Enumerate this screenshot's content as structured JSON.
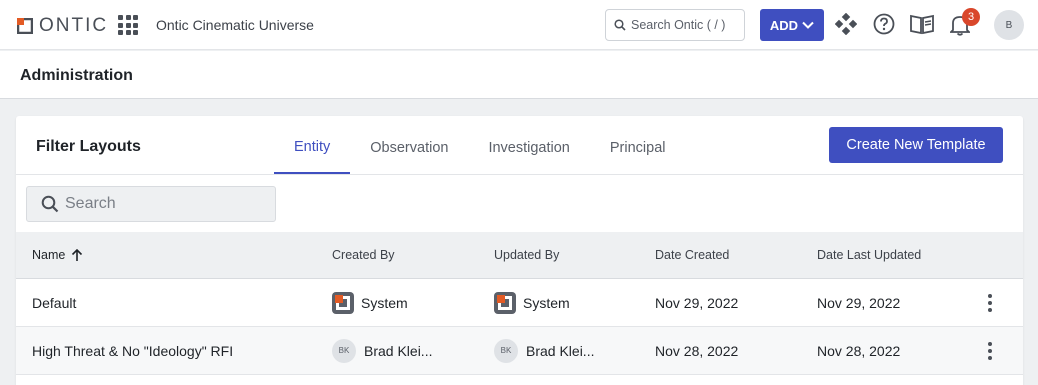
{
  "topbar": {
    "logo_text": "ONTIC",
    "org_name": "Ontic Cinematic Universe",
    "search_placeholder": "Search Ontic ( / )",
    "add_label": "ADD",
    "notification_count": "3",
    "user_initial": "B"
  },
  "admin": {
    "title": "Administration"
  },
  "filter_layouts": {
    "title": "Filter Layouts",
    "tabs": [
      {
        "label": "Entity",
        "active": true
      },
      {
        "label": "Observation",
        "active": false
      },
      {
        "label": "Investigation",
        "active": false
      },
      {
        "label": "Principal",
        "active": false
      }
    ],
    "create_label": "Create New Template",
    "search_placeholder": "Search"
  },
  "table": {
    "columns": [
      "Name",
      "Created By",
      "Updated By",
      "Date Created",
      "Date Last Updated"
    ],
    "rows": [
      {
        "name": "Default",
        "created_by": "System",
        "created_by_type": "system",
        "updated_by": "System",
        "updated_by_type": "system",
        "date_created": "Nov 29, 2022",
        "date_updated": "Nov 29, 2022"
      },
      {
        "name": "High Threat & No \"Ideology\" RFI",
        "created_by": "Brad Klei...",
        "created_by_initials": "BK",
        "updated_by": "Brad Klei...",
        "updated_by_initials": "BK",
        "date_created": "Nov 28, 2022",
        "date_updated": "Nov 28, 2022"
      }
    ]
  },
  "colors": {
    "accent": "#3f4fc0",
    "brand_orange": "#e35b25",
    "badge": "#d9472b"
  }
}
